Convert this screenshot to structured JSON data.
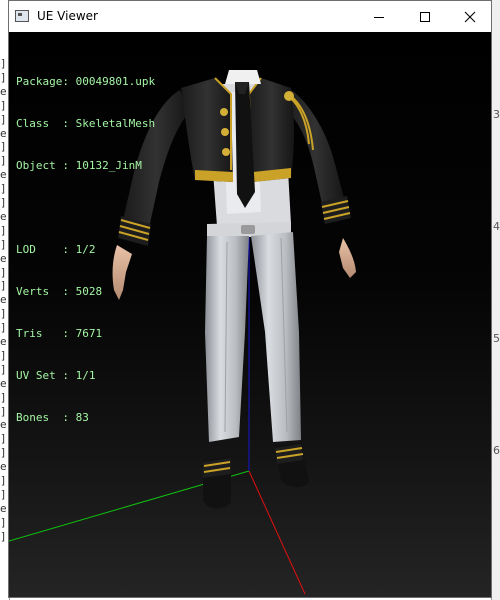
{
  "window": {
    "title": "UE Viewer",
    "controls": {
      "minimize": "—",
      "maximize": "☐",
      "close": "✕"
    }
  },
  "viewer": {
    "info_lines": [
      "Package: 00049801.upk",
      "Class  : SkeletalMesh",
      "Object : 10132_JinM"
    ],
    "stats_lines": [
      "LOD    : 1/2",
      "Verts  : 5028",
      "Tris   : 7671",
      "UV Set : 1/1",
      "Bones  : 83"
    ],
    "text_color": "#a4f5a4",
    "axis_colors": {
      "x": "#e01010",
      "y": "#10c010",
      "z": "#1010e0"
    }
  },
  "background_app": {
    "right_numbers": [
      "3",
      "4",
      "5",
      "6"
    ],
    "left_glyphs": [
      "]",
      "]",
      "e",
      "]",
      "]",
      "e",
      "]",
      "]",
      "e",
      "]",
      "]",
      "e",
      "]",
      "]",
      "e",
      "]",
      "]",
      "e",
      "]",
      "]",
      "e",
      "]",
      "]",
      "e",
      "]",
      "]",
      "e",
      "]",
      "]",
      "e",
      "]",
      "]",
      "e",
      "]",
      "]"
    ]
  }
}
